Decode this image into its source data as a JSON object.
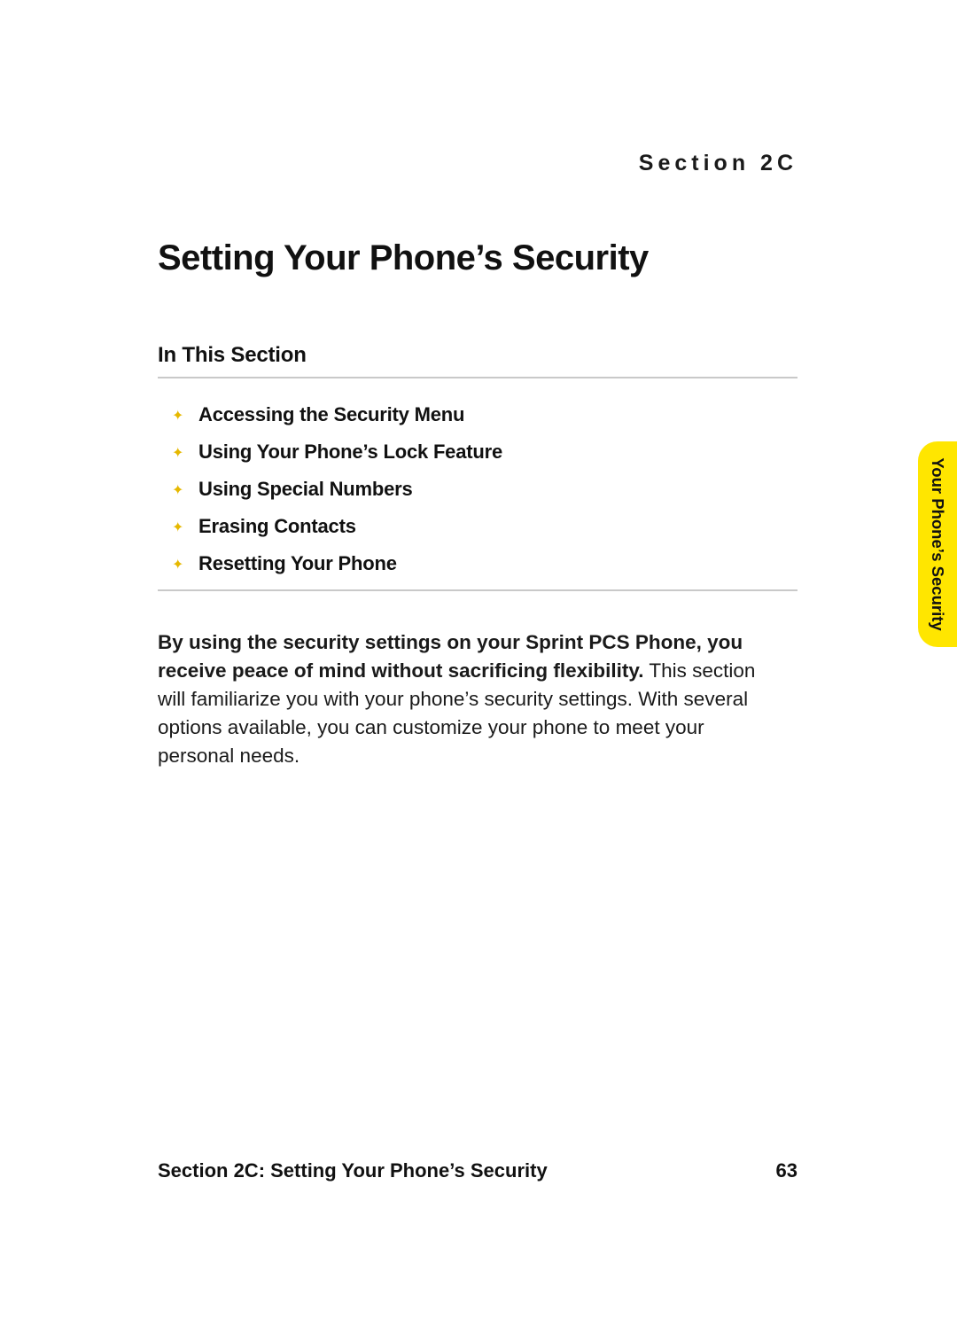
{
  "section_label": "Section 2C",
  "title": "Setting Your Phone’s Security",
  "subhead": "In This Section",
  "toc": [
    "Accessing the Security Menu",
    "Using Your Phone’s Lock Feature",
    "Using Special Numbers",
    "Erasing Contacts",
    "Resetting Your Phone"
  ],
  "body_lead": "By using the security settings on your Sprint PCS Phone, you receive peace of mind without sacrificing flexibility.",
  "body_rest": " This section will familiarize you with your phone’s security settings. With several options available, you can customize your phone to meet your personal needs.",
  "side_tab": "Your Phone’s Security",
  "footer_left": "Section 2C: Setting Your Phone’s Security",
  "footer_page": "63"
}
